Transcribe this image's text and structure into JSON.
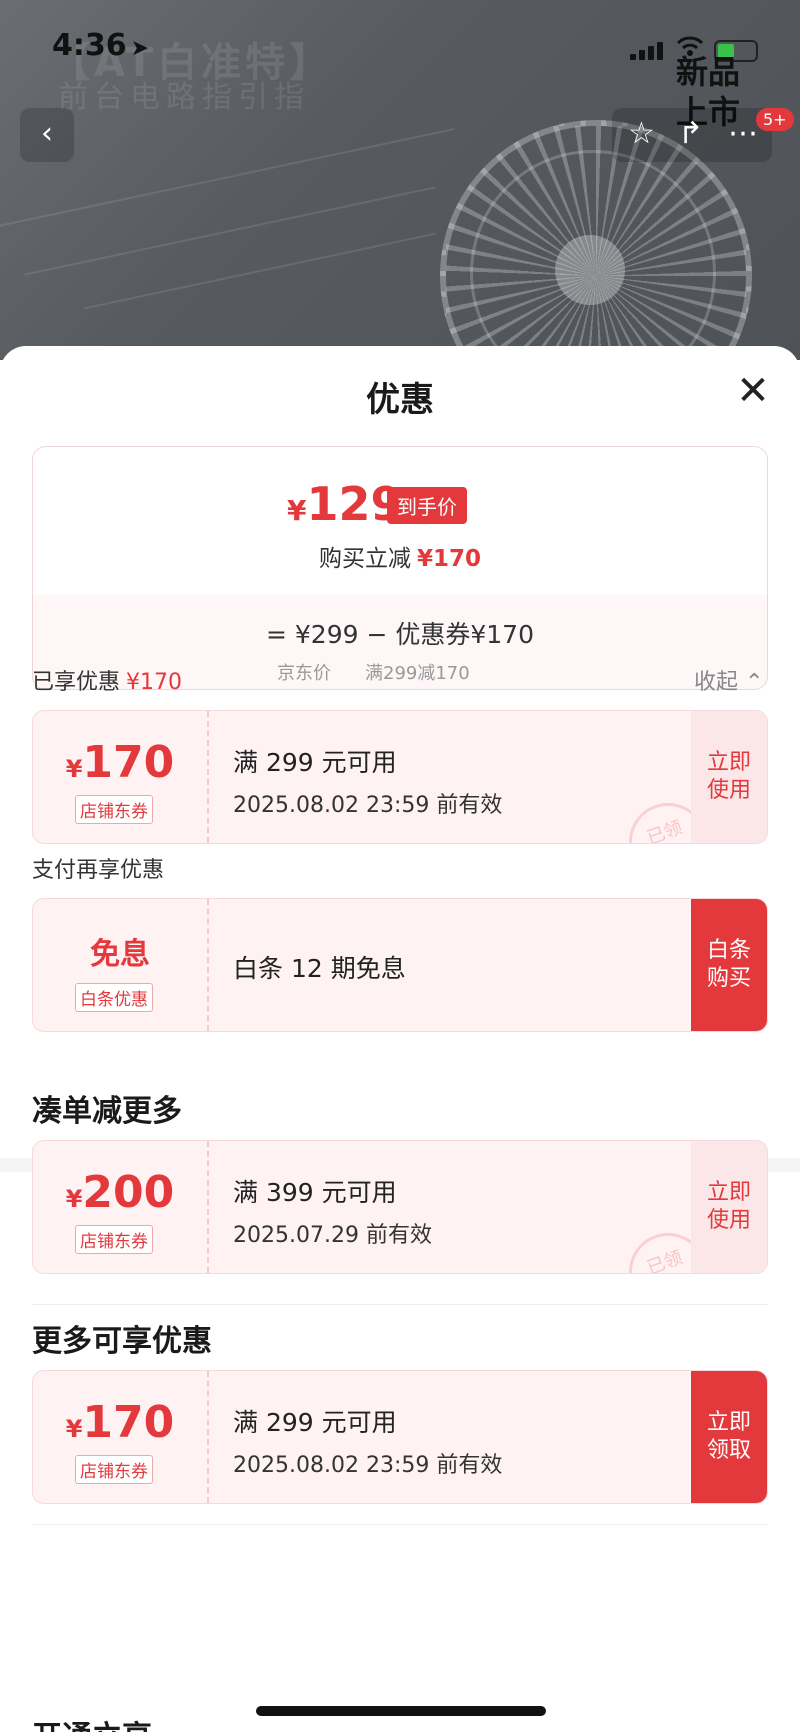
{
  "status_bar": {
    "time": "4:36"
  },
  "background": {
    "banner_line1": "【AT白准特】",
    "banner_line2": "前台电路指引指",
    "badge_line1": "新品",
    "badge_line2": "上市",
    "cart_count": "5+"
  },
  "sheet": {
    "title": "优惠",
    "price": {
      "yen": "¥",
      "final": "129",
      "tag": "到手价",
      "reduce_label": "购买立减",
      "reduce_value": "¥170",
      "formula": "=  ¥299  −  优惠券¥170",
      "jd_price_label": "京东价",
      "coupon_rule": "满299减170"
    },
    "enjoyed": {
      "label": "已享优惠",
      "value": "¥170",
      "collapse": "收起 ⌃"
    },
    "coupon1": {
      "yen": "¥",
      "amount": "170",
      "type": "店铺东券",
      "cond": "满 299 元可用",
      "expire": "2025.08.02 23:59 前有效",
      "action": "立即\n使用",
      "stamp": "已领"
    },
    "pay_section": "支付再享优惠",
    "coupon2": {
      "amount_text": "免息",
      "type": "白条优惠",
      "cond": "白条 12 期免息",
      "action": "白条\n购买"
    },
    "more_order_title": "凑单减更多",
    "coupon3": {
      "yen": "¥",
      "amount": "200",
      "type": "店铺东券",
      "cond": "满 399 元可用",
      "expire": "2025.07.29 前有效",
      "action": "立即\n使用",
      "stamp": "已领"
    },
    "more_benefit_title": "更多可享优惠",
    "coupon4": {
      "yen": "¥",
      "amount": "170",
      "type": "店铺东券",
      "cond": "满 299 元可用",
      "expire": "2025.08.02 23:59 前有效",
      "action": "立即\n领取"
    },
    "cut_off_title": "开通立享"
  },
  "colors": {
    "accent": "#e4393c",
    "coupon_bg": "#fff2f3"
  }
}
